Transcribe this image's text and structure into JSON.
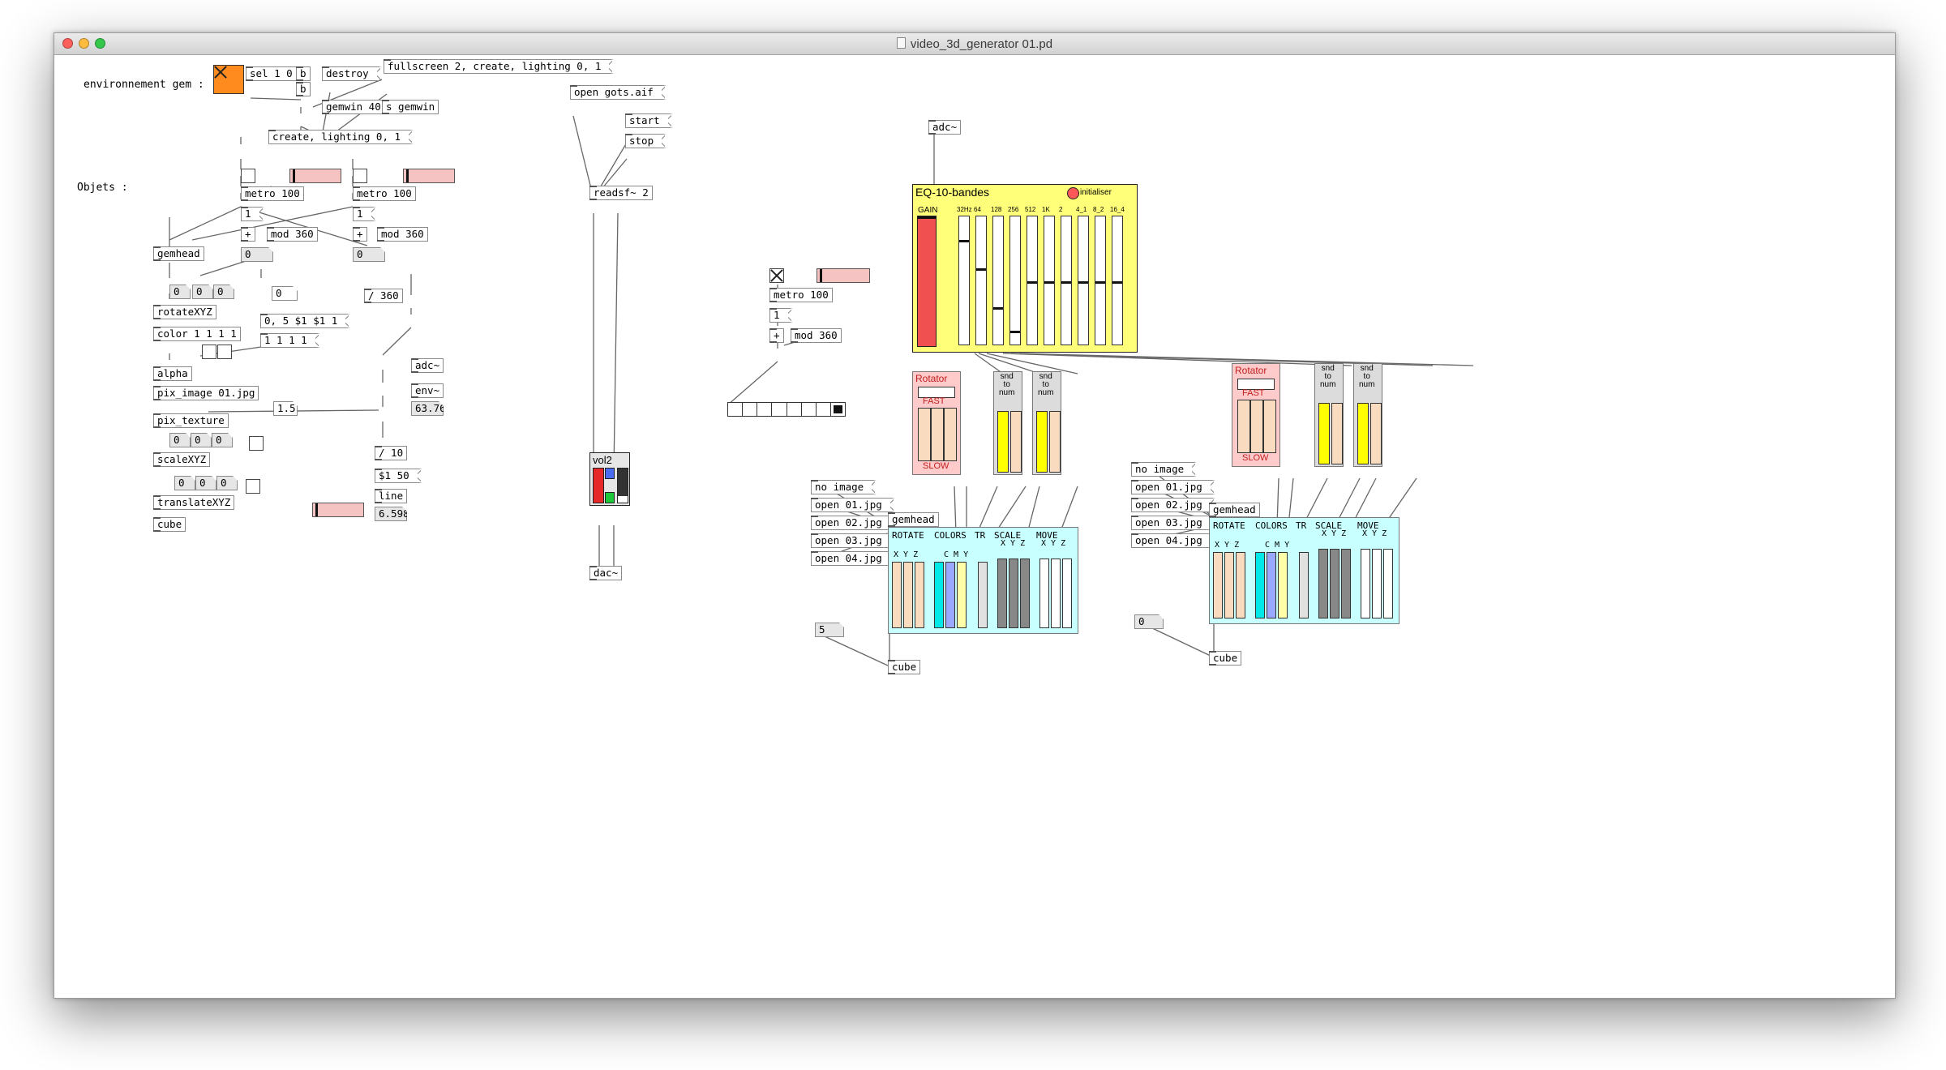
{
  "window": {
    "title": "video_3d_generator 01.pd",
    "traffic_lights": {
      "close": "#fc605b",
      "minimize": "#fdbc40",
      "zoom": "#34c84a"
    }
  },
  "colors": {
    "gop_yellow": "#ffff7a",
    "gop_cyan": "#c8ffff",
    "gop_pink": "#ffcaca",
    "gop_grey": "#dcdcdc",
    "slider_peach": "#f9dcc0",
    "gain_red": "#f05050",
    "toggle_orange": "#ff8a1e"
  },
  "comments": {
    "env": "environnement gem :",
    "objets": "Objets :"
  },
  "gem_section": {
    "sel": "sel 1 0",
    "bang1": "b",
    "bang2": "b",
    "destroy": "destroy",
    "fullscreen_msg": "fullscreen 2, create, lighting 0, 1",
    "gemwin": "gemwin 40",
    "s_gemwin": "s gemwin",
    "create_msg": "create, lighting 0, 1"
  },
  "objets_section": {
    "metro_a": "metro 100",
    "metro_b": "metro 100",
    "one_a": "1",
    "one_b": "1",
    "plus_a": "+",
    "plus_b": "+",
    "mod_a": "mod 360",
    "mod_b": "mod 360",
    "num_a": "0",
    "num_b": "0",
    "gemhead": "gemhead",
    "r0": "0",
    "r1": "0",
    "r2": "0",
    "num_c": "0",
    "div360": "/ 360",
    "rotate": "rotateXYZ",
    "color_msg1": "0, 5 $1 $1 1",
    "color": "color 1 1 1 1",
    "color_msg2": "1 1 1 1",
    "alpha": "alpha",
    "pix_image": "pix_image 01.jpg",
    "num_15": "1.5",
    "pix_texture": "pix_texture",
    "s0": "0",
    "s1": "0",
    "s2": "0",
    "scale": "scaleXYZ",
    "t0": "0",
    "t1": "0",
    "t2": "0",
    "translate": "translateXYZ",
    "cube": "cube",
    "adc": "adc~",
    "env": "env~",
    "env_val": "63.76",
    "div10": "/ 10",
    "line_msg": "$1 50",
    "line": "line",
    "line_val": "6.598"
  },
  "audio_section": {
    "open_msg": "open gots.aif",
    "start": "start",
    "stop": "stop",
    "readsf": "readsf~ 2",
    "vol_title": "vol2",
    "dac": "dac~"
  },
  "metro_section": {
    "metro": "metro 100",
    "one": "1",
    "plus": "+",
    "mod": "mod 360"
  },
  "eq": {
    "adc": "adc~",
    "title": "EQ-10-bandes",
    "init": "initialiser",
    "gain": "GAIN",
    "bands": [
      "32Hz",
      "64",
      "128",
      "256",
      "512",
      "1K",
      "2",
      "4_1",
      "8_2",
      "16_4"
    ],
    "band_levels": [
      0.82,
      0.6,
      0.3,
      0.12,
      0.5,
      0.5,
      0.5,
      0.5,
      0.5,
      0.5
    ]
  },
  "module1": {
    "rot_title": "Rotator",
    "fast": "FAST",
    "slow": "SLOW",
    "snd1": [
      "snd",
      "to",
      "num"
    ],
    "snd2": [
      "snd",
      "to",
      "num"
    ],
    "msgs": [
      "no image",
      "open 01.jpg",
      "open 02.jpg",
      "open 03.jpg",
      "open 04.jpg"
    ],
    "gemhead": "gemhead",
    "sections": [
      "ROTATE",
      "COLORS",
      "TR",
      "SCALE",
      "MOVE"
    ],
    "xyz": "X Y Z",
    "cmy": "C M Y",
    "num5": "5",
    "cube": "cube"
  },
  "module2": {
    "rot_title": "Rotator",
    "fast": "FAST",
    "slow": "SLOW",
    "snd1": [
      "snd",
      "to",
      "num"
    ],
    "snd2": [
      "snd",
      "to",
      "num"
    ],
    "msgs": [
      "no image",
      "open 01.jpg",
      "open 02.jpg",
      "open 03.jpg",
      "open 04.jpg"
    ],
    "gemhead": "gemhead",
    "sections": [
      "ROTATE",
      "COLORS",
      "TR",
      "SCALE",
      "MOVE"
    ],
    "xyz": "X Y Z",
    "cmy": "C M Y",
    "num0": "0",
    "cube": "cube"
  }
}
